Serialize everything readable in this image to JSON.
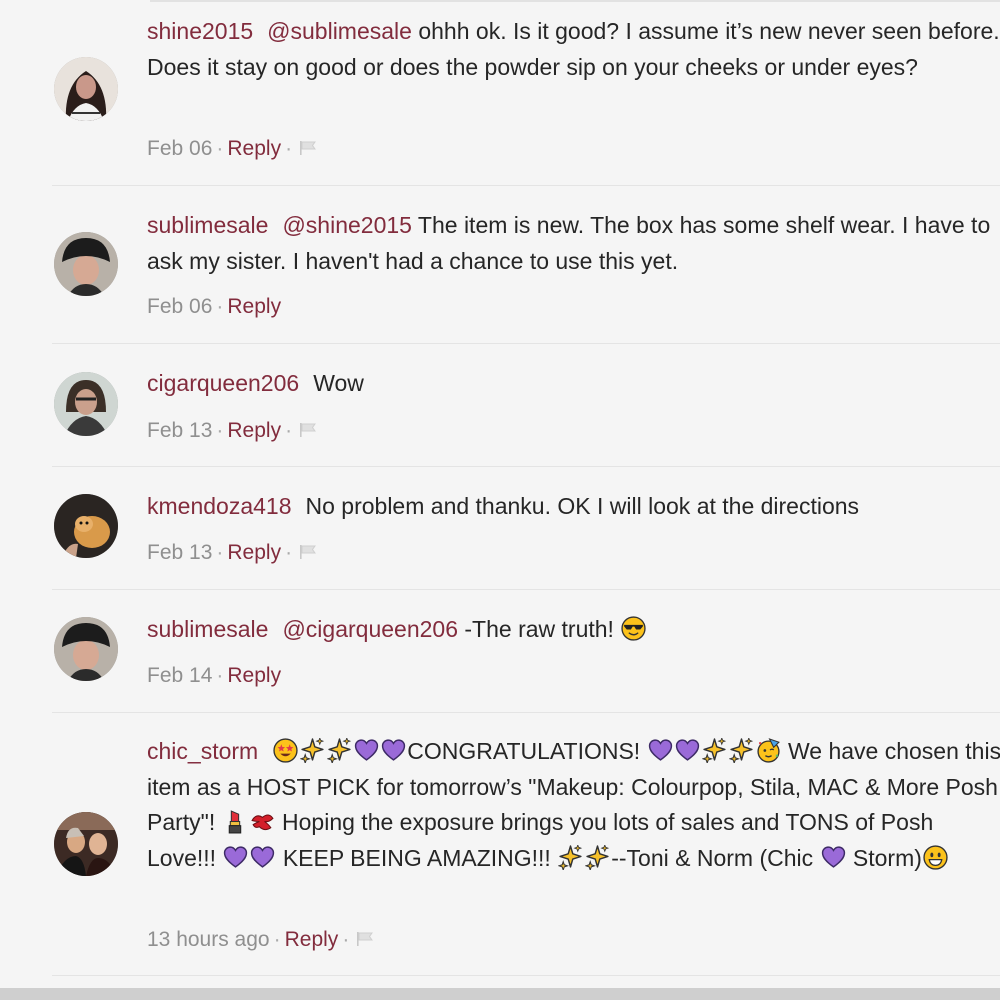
{
  "comments": [
    {
      "username": "shine2015",
      "mention": "@sublimesale",
      "body": " ohhh ok. Is it good? I assume it’s new never seen before. Does it stay on good or does the powder sip on your cheeks or under eyes?",
      "date": "Feb 06",
      "reply": "Reply"
    },
    {
      "username": "sublimesale",
      "mention": "@shine2015",
      "body": " The item is new. The box has some shelf wear. I have to ask my sister. I haven't had a chance to use this yet.",
      "date": "Feb 06",
      "reply": "Reply"
    },
    {
      "username": "cigarqueen206",
      "body": "Wow",
      "date": "Feb 13",
      "reply": "Reply"
    },
    {
      "username": "kmendoza418",
      "body": "No problem and thanku. OK I will look at the directions",
      "date": "Feb 13",
      "reply": "Reply"
    },
    {
      "username": "sublimesale",
      "mention": "@cigarqueen206",
      "body": " -The raw truth!",
      "date": "Feb 14",
      "reply": "Reply"
    },
    {
      "username": "chic_storm",
      "t1": "CONGRATULATIONS!",
      "t2": " We have chosen this item as a HOST PICK for tomorrow’s \"Makeup: Colourpop, Stila, MAC & More Posh Party\"!",
      "t3": " Hoping the exposure brings you lots of sales and TONS of Posh Love!!!",
      "t4": " KEEP BEING AMAZING!!!",
      "t5": "--Toni & Norm (Chic",
      "t6": " Storm)",
      "date": "13 hours ago",
      "reply": "Reply"
    }
  ],
  "separator": "·",
  "icons": {
    "flag": "flag-icon",
    "emoji": [
      "star-struck-emoji",
      "sparkles-emoji",
      "purple-heart-emoji",
      "sunglasses-emoji",
      "partying-face-emoji",
      "lipstick-emoji",
      "kiss-mark-emoji",
      "grinning-face-emoji"
    ]
  },
  "colors": {
    "username": "#822c3d",
    "text": "#262626",
    "meta": "#8f8f8f",
    "background": "#f5f5f5"
  }
}
